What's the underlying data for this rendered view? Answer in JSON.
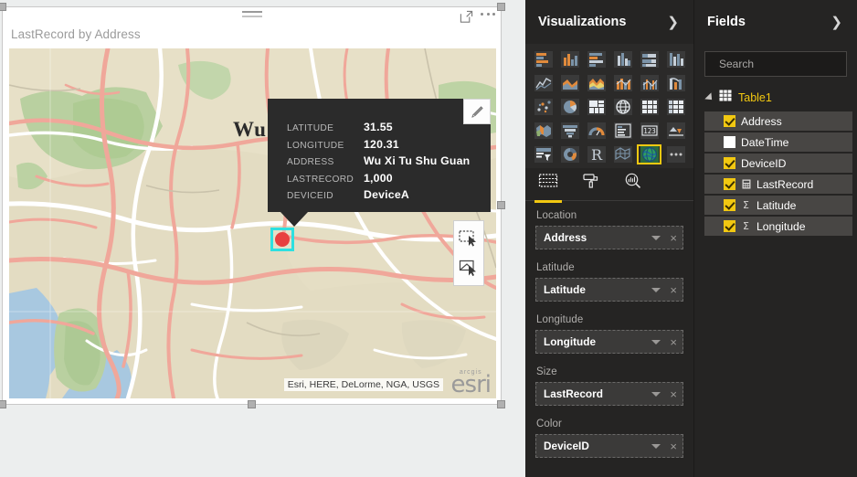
{
  "visual": {
    "title": "LastRecord by Address",
    "header_icons": [
      {
        "name": "focus-mode-icon",
        "label": "Focus mode"
      },
      {
        "name": "more-options-icon",
        "label": "More options"
      }
    ],
    "drag_handle_label": "Drag handle"
  },
  "map": {
    "city_label": "Wu",
    "attribution": "Esri, HERE, DeLorme, NGA, USGS",
    "esri_logo_top": "arcgis",
    "esri_logo_name": "esri",
    "marker": {
      "name": "map-data-point",
      "color": "#e84040",
      "selection_color": "#2ee0e0"
    },
    "tools": [
      {
        "name": "rectangle-select-tool",
        "label": "Rectangle selection"
      },
      {
        "name": "lasso-select-tool",
        "label": "Lasso selection"
      }
    ],
    "edit_button": {
      "name": "sketch-edit-button",
      "label": "Edit"
    }
  },
  "tooltip": {
    "rows": [
      {
        "key": "LATITUDE",
        "value": "31.55"
      },
      {
        "key": "LONGITUDE",
        "value": "120.31"
      },
      {
        "key": "ADDRESS",
        "value": "Wu Xi Tu Shu Guan"
      },
      {
        "key": "LASTRECORD",
        "value": "1,000"
      },
      {
        "key": "DEVICEID",
        "value": "DeviceA"
      }
    ]
  },
  "visualizations": {
    "title": "Visualizations",
    "expand_icon": "chevron-right-icon",
    "icons": [
      {
        "name": "stacked-bar-chart-icon",
        "selected": false
      },
      {
        "name": "stacked-column-chart-icon",
        "selected": false
      },
      {
        "name": "clustered-bar-chart-icon",
        "selected": false
      },
      {
        "name": "clustered-column-chart-icon",
        "selected": false
      },
      {
        "name": "hundred-percent-stacked-bar-chart-icon",
        "selected": false
      },
      {
        "name": "hundred-percent-stacked-column-chart-icon",
        "selected": false
      },
      {
        "name": "line-chart-icon",
        "selected": false
      },
      {
        "name": "area-chart-icon",
        "selected": false
      },
      {
        "name": "stacked-area-chart-icon",
        "selected": false
      },
      {
        "name": "line-stacked-column-chart-icon",
        "selected": false
      },
      {
        "name": "line-clustered-column-chart-icon",
        "selected": false
      },
      {
        "name": "ribbon-chart-icon",
        "selected": false
      },
      {
        "name": "scatter-chart-icon",
        "selected": false
      },
      {
        "name": "pie-chart-icon",
        "selected": false
      },
      {
        "name": "treemap-icon",
        "selected": false
      },
      {
        "name": "map-icon",
        "selected": false
      },
      {
        "name": "table-icon",
        "selected": false
      },
      {
        "name": "matrix-icon",
        "selected": false
      },
      {
        "name": "filled-map-icon",
        "selected": false
      },
      {
        "name": "funnel-chart-icon",
        "selected": false
      },
      {
        "name": "gauge-icon",
        "selected": false
      },
      {
        "name": "multi-row-card-icon",
        "selected": false
      },
      {
        "name": "card-icon",
        "selected": false
      },
      {
        "name": "kpi-icon",
        "selected": false
      },
      {
        "name": "slicer-icon",
        "selected": false
      },
      {
        "name": "donut-chart-icon",
        "selected": false
      },
      {
        "name": "r-script-visual-icon",
        "selected": false
      },
      {
        "name": "shape-map-icon",
        "selected": false
      },
      {
        "name": "arcgis-maps-icon",
        "selected": true
      },
      {
        "name": "more-visuals-icon",
        "selected": false
      }
    ],
    "tabs": [
      {
        "name": "tab-fields",
        "icon": "fields-table-icon",
        "active": true
      },
      {
        "name": "tab-format",
        "icon": "paint-roller-icon",
        "active": false
      },
      {
        "name": "tab-analytics",
        "icon": "analytics-magnifier-icon",
        "active": false
      }
    ],
    "wells": [
      {
        "label": "Location",
        "value": "Address"
      },
      {
        "label": "Latitude",
        "value": "Latitude"
      },
      {
        "label": "Longitude",
        "value": "Longitude"
      },
      {
        "label": "Size",
        "value": "LastRecord"
      },
      {
        "label": "Color",
        "value": "DeviceID"
      }
    ]
  },
  "fields": {
    "title": "Fields",
    "expand_icon": "chevron-right-icon",
    "search": {
      "placeholder": "Search",
      "value": "",
      "icon": "search-icon"
    },
    "table": {
      "name": "Table1",
      "icon": "table-grid-icon",
      "expanded": true
    },
    "items": [
      {
        "name": "Address",
        "checked": true,
        "type_icon": ""
      },
      {
        "name": "DateTime",
        "checked": false,
        "type_icon": ""
      },
      {
        "name": "DeviceID",
        "checked": true,
        "type_icon": ""
      },
      {
        "name": "LastRecord",
        "checked": true,
        "type_icon": "calculator"
      },
      {
        "name": "Latitude",
        "checked": true,
        "type_icon": "sigma"
      },
      {
        "name": "Longitude",
        "checked": true,
        "type_icon": "sigma"
      }
    ]
  },
  "colors": {
    "accent": "#f2c811",
    "pane_bg": "#252423",
    "tooltip_bg": "#2b2b2b",
    "marker": "#e84040",
    "selection": "#2ee0e0",
    "map_land": "#e3dcc2",
    "map_green": "#b9d0a0",
    "map_water": "#a8c8e0",
    "map_road": "#f0a79a"
  }
}
